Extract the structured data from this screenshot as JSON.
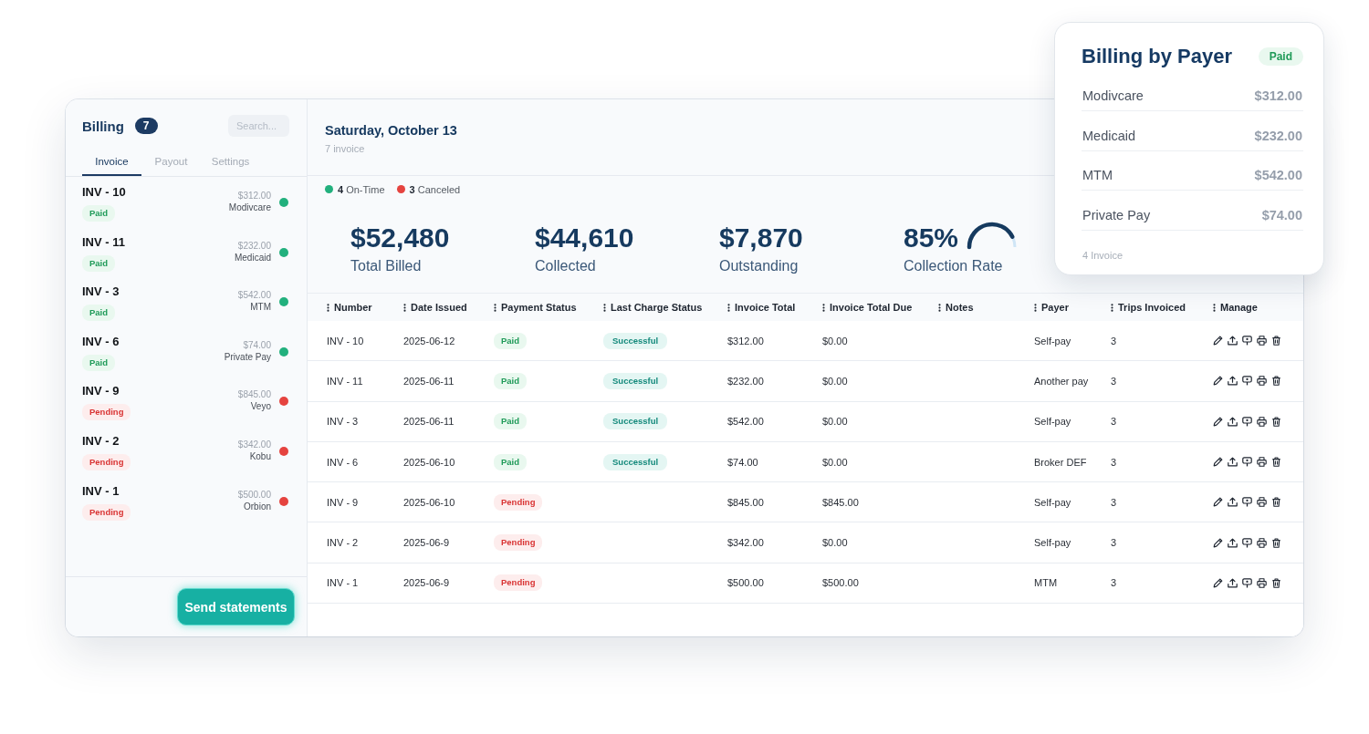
{
  "sidebar": {
    "title": "Billing",
    "count": "7",
    "search": {
      "placeholder": "Search..."
    },
    "tabs": [
      {
        "label": "Invoice",
        "selected": true
      },
      {
        "label": "Payout",
        "selected": false
      },
      {
        "label": "Settings",
        "selected": false
      }
    ],
    "invoices": [
      {
        "number": "INV - 10",
        "status": {
          "label": "Paid",
          "kind": "paid"
        },
        "amount": "$312.00",
        "payer": "Modivcare",
        "color": "#22b07d"
      },
      {
        "number": "INV - 11",
        "status": {
          "label": "Paid",
          "kind": "paid"
        },
        "amount": "$232.00",
        "payer": "Medicaid",
        "color": "#22b07d"
      },
      {
        "number": "INV - 3",
        "status": {
          "label": "Paid",
          "kind": "paid"
        },
        "amount": "$542.00",
        "payer": "MTM",
        "color": "#22b07d"
      },
      {
        "number": "INV - 6",
        "status": {
          "label": "Paid",
          "kind": "paid"
        },
        "amount": "$74.00",
        "payer": "Private Pay",
        "color": "#22b07d"
      },
      {
        "number": "INV - 9",
        "status": {
          "label": "Pending",
          "kind": "pending"
        },
        "amount": "$845.00",
        "payer": "Veyo",
        "color": "#e5433f"
      },
      {
        "number": "INV - 2",
        "status": {
          "label": "Pending",
          "kind": "pending"
        },
        "amount": "$342.00",
        "payer": "Kobu",
        "color": "#e5433f"
      },
      {
        "number": "INV - 1",
        "status": {
          "label": "Pending",
          "kind": "pending"
        },
        "amount": "$500.00",
        "payer": "Orbion",
        "color": "#e5433f"
      }
    ],
    "button": "Send statements"
  },
  "header": {
    "title": "Saturday, October 13",
    "subtitle": "7 invoice"
  },
  "legend": [
    {
      "text": "**4** On-Time",
      "color": "#22b07d"
    },
    {
      "text": "**3** Canceled",
      "color": "#e5433f"
    }
  ],
  "stats": [
    {
      "kind": "plain",
      "value": "$52,480",
      "label": "Total Billed"
    },
    {
      "kind": "plain",
      "value": "$44,610",
      "label": "Collected"
    },
    {
      "kind": "plain",
      "value": "$7,870",
      "label": "Outstanding"
    },
    {
      "kind": "gauge",
      "value": "85%",
      "label": "Collection Rate",
      "level": 0.85
    }
  ],
  "table": {
    "columns": [
      "Number",
      "Date Issued",
      "Payment Status",
      "Last Charge Status",
      "Invoice Total",
      "Invoice Total Due",
      "Notes",
      "Payer",
      "Trips Invoiced",
      "Manage"
    ],
    "rows": [
      {
        "number": "INV - 10",
        "date_issued": "2025-06-12",
        "payment_status": {
          "label": "Paid",
          "kind": "paid"
        },
        "last_charge_status": {
          "label": "Successful",
          "kind": "success"
        },
        "invoice_total": "$312.00",
        "invoice_total_due": "$0.00",
        "payer": "Self-pay",
        "trips_invoiced": "3"
      },
      {
        "number": "INV - 11",
        "date_issued": "2025-06-11",
        "payment_status": {
          "label": "Paid",
          "kind": "paid"
        },
        "last_charge_status": {
          "label": "Successful",
          "kind": "success"
        },
        "invoice_total": "$232.00",
        "invoice_total_due": "$0.00",
        "payer": "Another pay",
        "trips_invoiced": "3"
      },
      {
        "number": "INV - 3",
        "date_issued": "2025-06-11",
        "payment_status": {
          "label": "Paid",
          "kind": "paid"
        },
        "last_charge_status": {
          "label": "Successful",
          "kind": "success"
        },
        "invoice_total": "$542.00",
        "invoice_total_due": "$0.00",
        "payer": "Self-pay",
        "trips_invoiced": "3"
      },
      {
        "number": "INV - 6",
        "date_issued": "2025-06-10",
        "payment_status": {
          "label": "Paid",
          "kind": "paid"
        },
        "last_charge_status": {
          "label": "Successful",
          "kind": "success"
        },
        "invoice_total": "$74.00",
        "invoice_total_due": "$0.00",
        "payer": "Broker DEF",
        "trips_invoiced": "3"
      },
      {
        "number": "INV - 9",
        "date_issued": "2025-06-10",
        "payment_status": {
          "label": "Pending",
          "kind": "pending"
        },
        "invoice_total": "$845.00",
        "invoice_total_due": "$845.00",
        "payer": "Self-pay",
        "trips_invoiced": "3"
      },
      {
        "number": "INV - 2",
        "date_issued": "2025-06-9",
        "payment_status": {
          "label": "Pending",
          "kind": "pending"
        },
        "invoice_total": "$342.00",
        "invoice_total_due": "$0.00",
        "payer": "Self-pay",
        "trips_invoiced": "3"
      },
      {
        "number": "INV - 1",
        "date_issued": "2025-06-9",
        "payment_status": {
          "label": "Pending",
          "kind": "pending"
        },
        "invoice_total": "$500.00",
        "invoice_total_due": "$500.00",
        "payer": "MTM",
        "trips_invoiced": "3"
      }
    ]
  },
  "billing_by_payer": {
    "title": "Billing by Payer",
    "badge": {
      "label": "Paid",
      "kind": "paid"
    },
    "rows": [
      {
        "payer": "Modivcare",
        "amount": "$312.00"
      },
      {
        "payer": "Medicaid",
        "amount": "$232.00"
      },
      {
        "payer": "MTM",
        "amount": "$542.00"
      },
      {
        "payer": "Private Pay",
        "amount": "$74.00"
      }
    ],
    "footer": "4 Invoice"
  }
}
